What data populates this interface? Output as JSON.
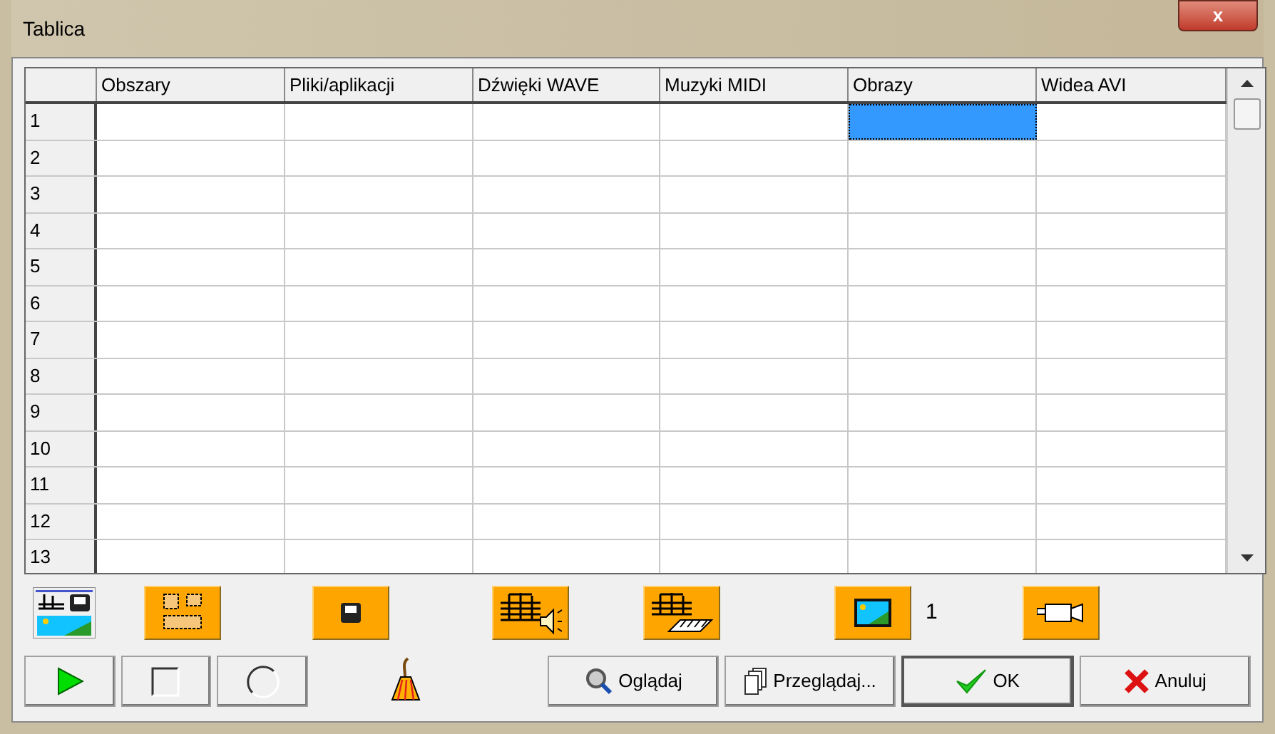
{
  "window": {
    "title": "Tablica",
    "close_label": "x"
  },
  "table": {
    "columns": [
      "Obszary",
      "Pliki/aplikacji",
      "Dźwięki WAVE",
      "Muzyki MIDI",
      "Obrazy",
      "Widea AVI"
    ],
    "rows": [
      {
        "label": "1",
        "cells": [
          {
            "selected": false
          },
          {
            "selected": false
          },
          {
            "selected": false
          },
          {
            "selected": false
          },
          {
            "selected": true
          },
          {
            "selected": false
          }
        ]
      },
      {
        "label": "2",
        "cells": [
          {
            "selected": false
          },
          {
            "selected": false
          },
          {
            "selected": false
          },
          {
            "selected": false
          },
          {
            "selected": false
          },
          {
            "selected": false
          }
        ]
      },
      {
        "label": "3",
        "cells": [
          {
            "selected": false
          },
          {
            "selected": false
          },
          {
            "selected": false
          },
          {
            "selected": false
          },
          {
            "selected": false
          },
          {
            "selected": false
          }
        ]
      },
      {
        "label": "4",
        "cells": [
          {
            "selected": false
          },
          {
            "selected": false
          },
          {
            "selected": false
          },
          {
            "selected": false
          },
          {
            "selected": false
          },
          {
            "selected": false
          }
        ]
      },
      {
        "label": "5",
        "cells": [
          {
            "selected": false
          },
          {
            "selected": false
          },
          {
            "selected": false
          },
          {
            "selected": false
          },
          {
            "selected": false
          },
          {
            "selected": false
          }
        ]
      },
      {
        "label": "6",
        "cells": [
          {
            "selected": false
          },
          {
            "selected": false
          },
          {
            "selected": false
          },
          {
            "selected": false
          },
          {
            "selected": false
          },
          {
            "selected": false
          }
        ]
      },
      {
        "label": "7",
        "cells": [
          {
            "selected": false
          },
          {
            "selected": false
          },
          {
            "selected": false
          },
          {
            "selected": false
          },
          {
            "selected": false
          },
          {
            "selected": false
          }
        ]
      },
      {
        "label": "8",
        "cells": [
          {
            "selected": false
          },
          {
            "selected": false
          },
          {
            "selected": false
          },
          {
            "selected": false
          },
          {
            "selected": false
          },
          {
            "selected": false
          }
        ]
      },
      {
        "label": "9",
        "cells": [
          {
            "selected": false
          },
          {
            "selected": false
          },
          {
            "selected": false
          },
          {
            "selected": false
          },
          {
            "selected": false
          },
          {
            "selected": false
          }
        ]
      },
      {
        "label": "10",
        "cells": [
          {
            "selected": false
          },
          {
            "selected": false
          },
          {
            "selected": false
          },
          {
            "selected": false
          },
          {
            "selected": false
          },
          {
            "selected": false
          }
        ]
      },
      {
        "label": "11",
        "cells": [
          {
            "selected": false
          },
          {
            "selected": false
          },
          {
            "selected": false
          },
          {
            "selected": false
          },
          {
            "selected": false
          },
          {
            "selected": false
          }
        ]
      },
      {
        "label": "12",
        "cells": [
          {
            "selected": false
          },
          {
            "selected": false
          },
          {
            "selected": false
          },
          {
            "selected": false
          },
          {
            "selected": false
          },
          {
            "selected": false
          }
        ]
      },
      {
        "label": "13",
        "cells": [
          {
            "selected": false
          },
          {
            "selected": false
          },
          {
            "selected": false
          },
          {
            "selected": false
          },
          {
            "selected": false
          },
          {
            "selected": false
          }
        ]
      }
    ]
  },
  "toolbar": [
    {
      "kind": "media"
    },
    {
      "kind": "layout"
    },
    {
      "kind": "save"
    },
    {
      "kind": "wave"
    },
    {
      "kind": "midi"
    },
    {
      "kind": "image",
      "count": "1"
    },
    {
      "kind": "video"
    }
  ],
  "controls": [
    {
      "kind": "play"
    },
    {
      "kind": "stop"
    },
    {
      "kind": "record"
    },
    {
      "kind": "broom"
    }
  ],
  "buttons": [
    {
      "kind": "view",
      "label": "Oglądaj"
    },
    {
      "kind": "browse",
      "label": "Przeglądaj..."
    },
    {
      "kind": "ok",
      "label": "OK"
    },
    {
      "kind": "cancel",
      "label": "Anuluj"
    }
  ]
}
